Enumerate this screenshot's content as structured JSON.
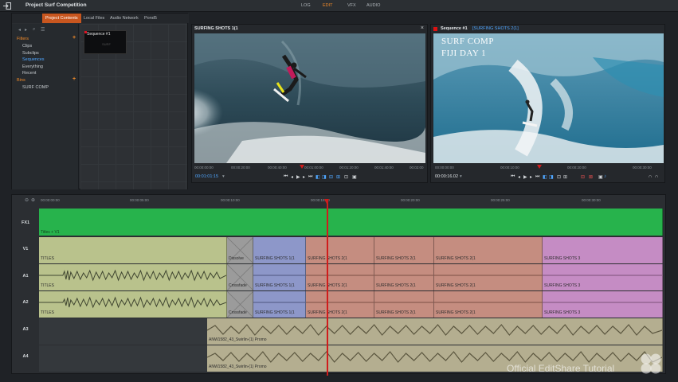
{
  "app": {
    "project_title": "Project Surf Competition",
    "modes": [
      {
        "label": "LOG"
      },
      {
        "label": "EDIT",
        "active": true
      },
      {
        "label": "VFX"
      },
      {
        "label": "AUDIO"
      }
    ]
  },
  "project_panel": {
    "tabs": [
      {
        "label": "Project Contents",
        "active": true
      },
      {
        "label": "Local Files"
      },
      {
        "label": "Audio Network"
      },
      {
        "label": "Pond5"
      }
    ],
    "tree": {
      "filters_header": "Filters",
      "filters": [
        "Clips",
        "Subclips",
        "Sequences",
        "Everything",
        "Recent"
      ],
      "selected": "Sequences",
      "bins_header": "Bins",
      "bins": [
        "SURF COMP"
      ]
    },
    "thumbnail": {
      "label": "Sequence #1",
      "sub": "SURF"
    }
  },
  "source_viewer": {
    "title": "SURFING SHOTS 1(1",
    "ruler": [
      "00:00:00:00",
      "00:00:20:00",
      "00:00:40:00",
      "00:01:00:00",
      "00:01:20:00",
      "00:01:40:00",
      "00:02:00"
    ],
    "timecode": "00:01:01:15"
  },
  "record_viewer": {
    "title": "Sequence #1",
    "title_extra": "[SURFING SHOTS 2(1]",
    "overlay_line1": "SURF COMP",
    "overlay_line2": "FIJI DAY 1",
    "ruler": [
      "00:00:00:00",
      "00:00:10:00",
      "00:00:20:00",
      "00:00:30:00"
    ],
    "timecode": "00:00:16.02"
  },
  "timeline": {
    "ruler": [
      "00:00:00:00",
      "00:00:05:00",
      "00:00:10:00",
      "00:00:15:00",
      "00:00:20:00",
      "00:00:25:00",
      "00:00:30:00"
    ],
    "tracks": [
      {
        "label": "FX1",
        "clips": [
          {
            "label": "Titles + V1"
          }
        ]
      },
      {
        "label": "V1",
        "clips": [
          {
            "label": "TITLES"
          },
          {
            "label": "Dissolve"
          },
          {
            "label": "SURFING SHOTS 1(1"
          },
          {
            "label": "SURFING SHOTS 2(1"
          },
          {
            "label": "SURFING SHOTS 2(1"
          },
          {
            "label": "SURFING SHOTS 2(1"
          },
          {
            "label": "SURFING SHOTS 3"
          }
        ]
      },
      {
        "label": "A1",
        "clips": [
          {
            "label": "TITLES"
          },
          {
            "label": "Crossfade"
          },
          {
            "label": "SURFING SHOTS 1(1"
          },
          {
            "label": "SURFING SHOTS 2(1"
          },
          {
            "label": "SURFING SHOTS 2(1"
          },
          {
            "label": "SURFING SHOTS 2(1"
          },
          {
            "label": "SURFING SHOTS 3"
          }
        ]
      },
      {
        "label": "A2",
        "clips": [
          {
            "label": "TITLES"
          },
          {
            "label": "Crossfade"
          },
          {
            "label": "SURFING SHOTS 1(1"
          },
          {
            "label": "SURFING SHOTS 2(1"
          },
          {
            "label": "SURFING SHOTS 2(1"
          },
          {
            "label": "SURFING SHOTS 2(1"
          },
          {
            "label": "SURFING SHOTS 3"
          }
        ]
      },
      {
        "label": "A3",
        "clips": [
          {
            "label": "ANW1582_43_Swirlin-(1) Promo"
          }
        ]
      },
      {
        "label": "A4",
        "clips": [
          {
            "label": "ANW1582_43_Swirlin-(1) Promo"
          }
        ]
      }
    ]
  },
  "watermark": "Official EditShare Tutorial",
  "colors": {
    "accent": "#f08a2a",
    "selection": "#4fa6ff",
    "fx_track": "#27b34c",
    "titles_clip": "#b9c28c",
    "transition": "#9b9b9b",
    "shots1_clip": "#8d97c9",
    "shots2_clip": "#c58d80",
    "shots3_clip": "#c58cc4",
    "music_clip": "#b4ae90",
    "playhead": "#d01c1c"
  }
}
